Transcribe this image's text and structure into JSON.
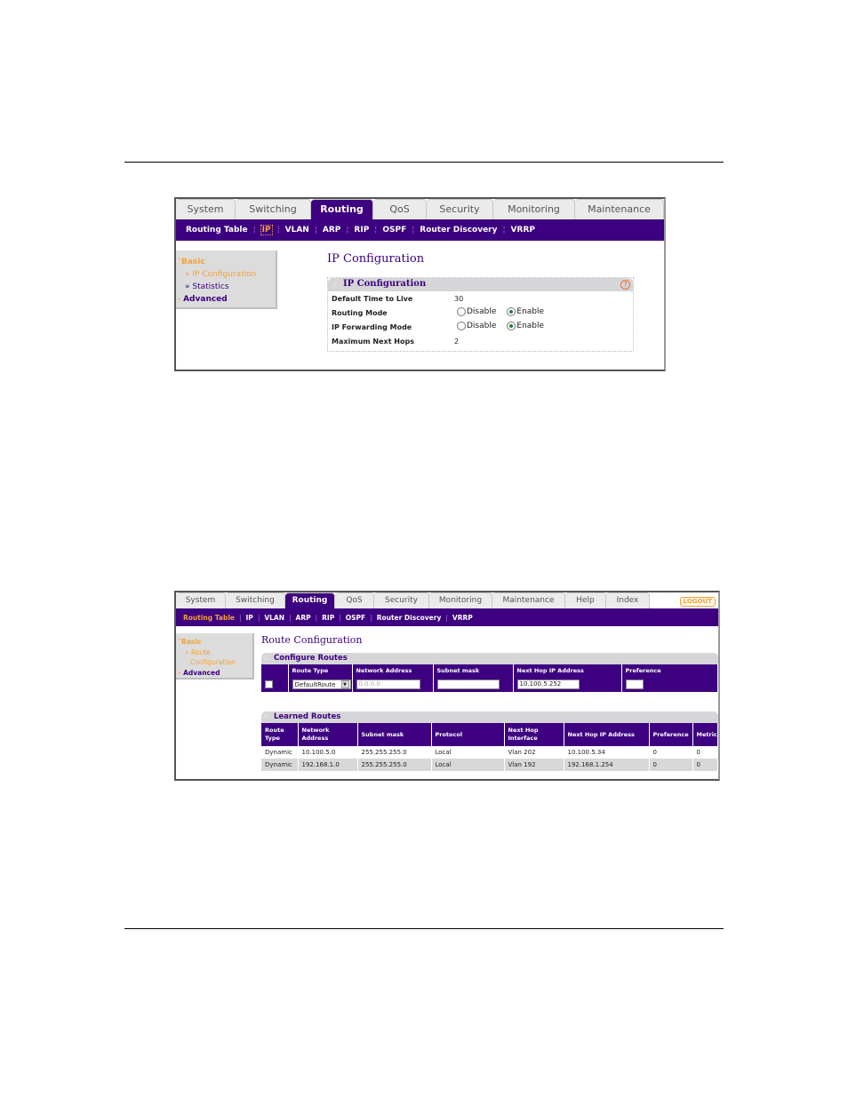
{
  "screenshot1": {
    "tabs": [
      "System",
      "Switching",
      "Routing",
      "QoS",
      "Security",
      "Monitoring",
      "Maintenance"
    ],
    "active_tab": "Routing",
    "subnav": [
      "Routing Table",
      "IP",
      "VLAN",
      "ARP",
      "RIP",
      "OSPF",
      "Router Discovery",
      "VRRP"
    ],
    "subnav_current": "IP",
    "sidebar": {
      "basic": "Basic",
      "items": [
        "IP Configuration",
        "Statistics"
      ],
      "advanced": "Advanced"
    },
    "page_title": "IP Configuration",
    "panel": {
      "title": "IP Configuration",
      "help_icon": "?",
      "rows": [
        {
          "label": "Default Time to Live",
          "value": "30"
        },
        {
          "label": "Routing Mode",
          "options": [
            "Disable",
            "Enable"
          ],
          "selected": "Enable"
        },
        {
          "label": "IP Forwarding Mode",
          "options": [
            "Disable",
            "Enable"
          ],
          "selected": "Enable"
        },
        {
          "label": "Maximum Next Hops",
          "value": "2"
        }
      ]
    }
  },
  "screenshot2": {
    "tabs": [
      "System",
      "Switching",
      "Routing",
      "QoS",
      "Security",
      "Monitoring",
      "Maintenance",
      "Help",
      "Index"
    ],
    "active_tab": "Routing",
    "logout_label": "LOGOUT",
    "subnav": [
      "Routing Table",
      "IP",
      "VLAN",
      "ARP",
      "RIP",
      "OSPF",
      "Router Discovery",
      "VRRP"
    ],
    "subnav_current": "Routing Table",
    "sidebar": {
      "basic": "Basic",
      "item_line1": "Route",
      "item_line2": "Configuration",
      "advanced": "Advanced"
    },
    "page_title": "Route Configuration",
    "configure_routes": {
      "title": "Configure Routes",
      "headers": [
        "",
        "Route Type",
        "Network Address",
        "Subnet mask",
        "Next Hop IP Address",
        "Preference"
      ],
      "route_type": "DefaultRoute",
      "network_address_placeholder": "0.0.0.0",
      "subnet_mask": "",
      "next_hop_ip": "10.100.5.252",
      "preference": ""
    },
    "learned_routes": {
      "title": "Learned Routes",
      "headers": [
        [
          "Route",
          "Type"
        ],
        [
          "Network",
          "Address"
        ],
        [
          "Subnet mask",
          ""
        ],
        [
          "Protocol",
          ""
        ],
        [
          "Next Hop",
          "Interface"
        ],
        [
          "Next Hop IP Address",
          ""
        ],
        [
          "Preference",
          ""
        ],
        [
          "Metric",
          ""
        ]
      ],
      "rows": [
        [
          "Dynamic",
          "10.100.5.0",
          "255.255.255.0",
          "Local",
          "Vlan 202",
          "10.100.5.34",
          "0",
          "0"
        ],
        [
          "Dynamic",
          "192.168.1.0",
          "255.255.255.0",
          "Local",
          "Vlan 192",
          "192.168.1.254",
          "0",
          "0"
        ]
      ]
    }
  },
  "colors": {
    "brand_purple": "#3d0080",
    "accent_orange": "#f2a23c",
    "help_orange": "#ee6f2d"
  }
}
